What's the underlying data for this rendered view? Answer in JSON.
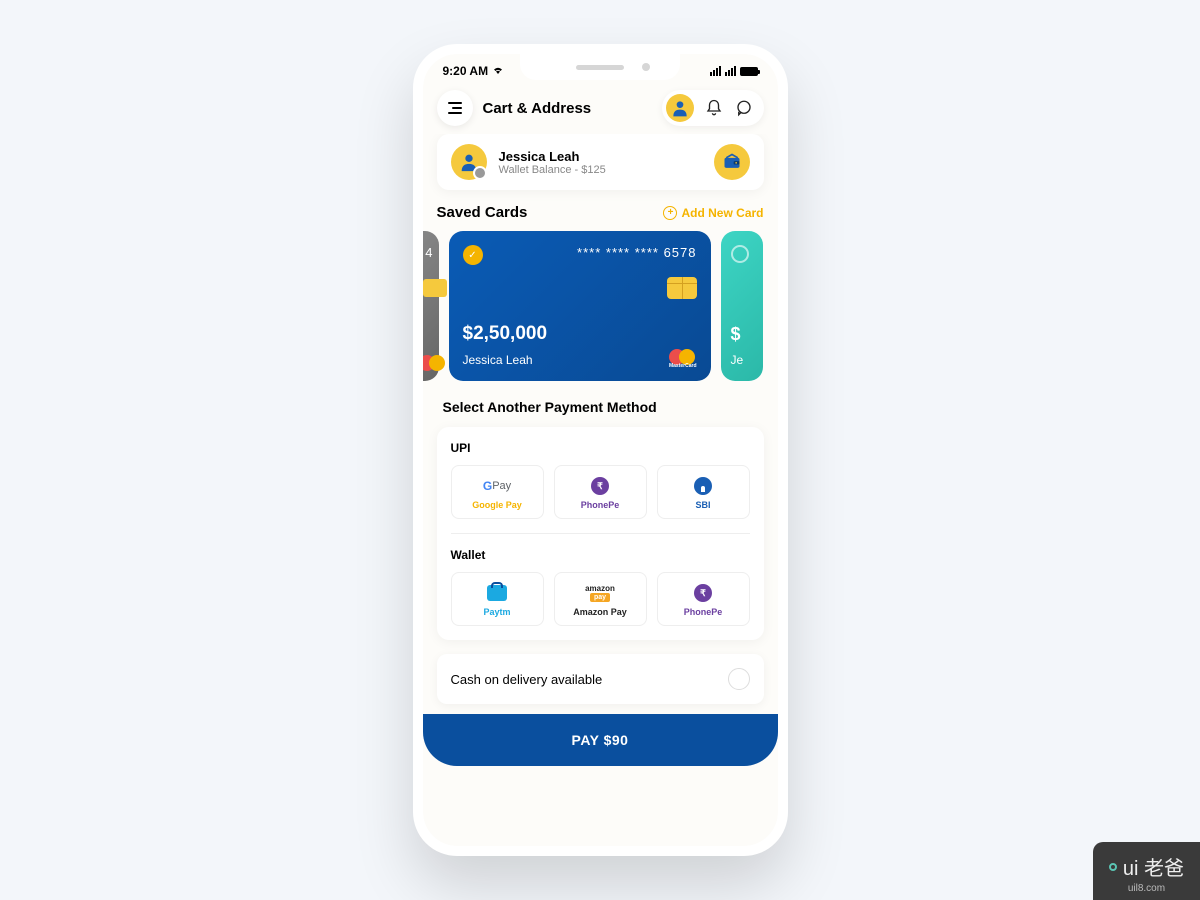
{
  "status": {
    "time": "9:20 AM"
  },
  "header": {
    "title": "Cart & Address"
  },
  "user": {
    "name": "Jessica Leah",
    "balance": "Wallet Balance - $125"
  },
  "savedCards": {
    "title": "Saved Cards",
    "addLabel": "Add New Card"
  },
  "card_left": {
    "digits": "4"
  },
  "card_main": {
    "number": "****  ****  ****  6578",
    "amount": "$2,50,000",
    "holder": "Jessica Leah",
    "brand": "MasterCard"
  },
  "card_right": {
    "amount_prefix": "$",
    "holder_prefix": "Je"
  },
  "alt": {
    "title": "Select Another Payment Method"
  },
  "upi": {
    "label": "UPI",
    "options": [
      {
        "name": "Google Pay"
      },
      {
        "name": "PhonePe"
      },
      {
        "name": "SBI"
      }
    ]
  },
  "wallet": {
    "label": "Wallet",
    "options": [
      {
        "name": "Paytm"
      },
      {
        "name": "Amazon Pay"
      },
      {
        "name": "PhonePe"
      }
    ]
  },
  "cod": {
    "label": "Cash on delivery available"
  },
  "pay": {
    "label": "PAY $90"
  },
  "watermark": {
    "brand": "ui 老爸",
    "url": "uil8.com"
  }
}
